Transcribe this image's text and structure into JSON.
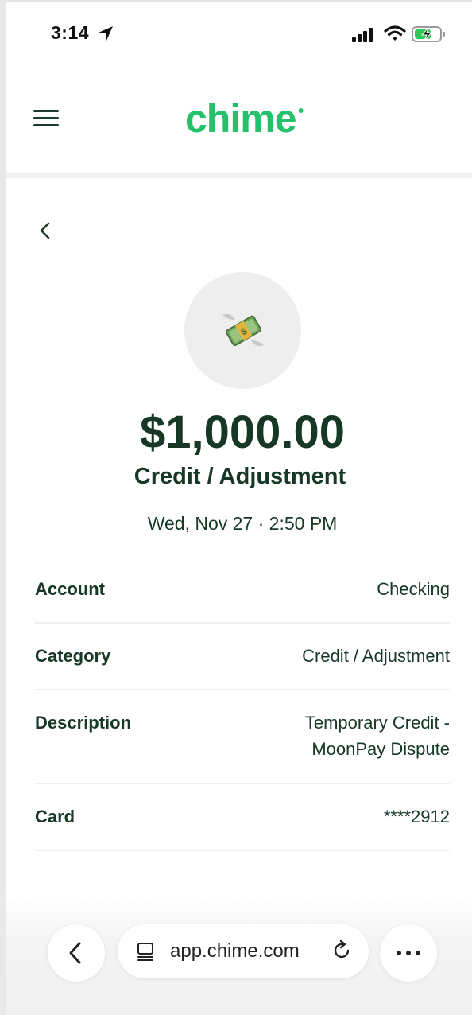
{
  "status_bar": {
    "time": "3:14"
  },
  "header": {
    "logo": "chime"
  },
  "transaction": {
    "amount": "$1,000.00",
    "type": "Credit / Adjustment",
    "datetime": "Wed, Nov 27 · 2:50 PM",
    "icon": "money-with-wings-icon"
  },
  "details": [
    {
      "label": "Account",
      "value": "Checking"
    },
    {
      "label": "Category",
      "value": "Credit / Adjustment"
    },
    {
      "label": "Description",
      "value_line1": "Temporary Credit -",
      "value_line2": "MoonPay Dispute"
    },
    {
      "label": "Card",
      "value": "****2912"
    }
  ],
  "browser": {
    "url": "app.chime.com"
  },
  "colors": {
    "brand": "#27c06a",
    "text": "#173826"
  }
}
